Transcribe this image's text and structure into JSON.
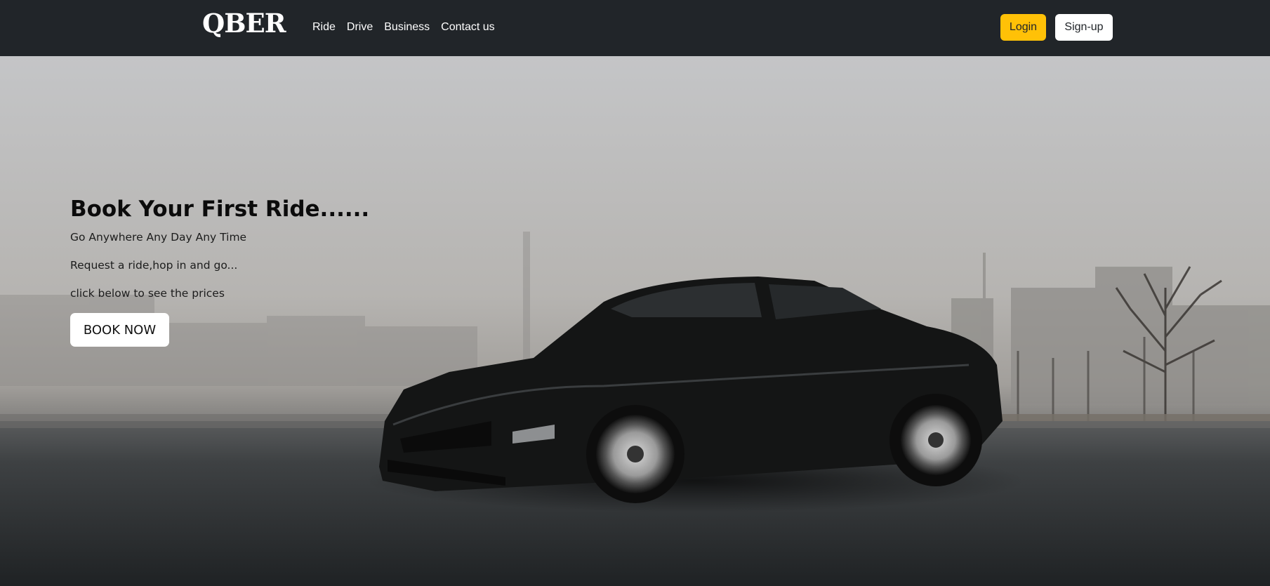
{
  "navbar": {
    "brand": "QBER",
    "links": [
      "Ride",
      "Drive",
      "Business",
      "Contact us"
    ],
    "login_label": "Login",
    "signup_label": "Sign-up"
  },
  "hero": {
    "title": "Book Your First Ride......",
    "line1": "Go Anywhere Any Day Any Time",
    "line2": "Request a ride,hop in and go...",
    "line3": "click below to see the prices",
    "button_label": "BOOK NOW",
    "background_image": "black sports car on foggy asphalt lot"
  },
  "colors": {
    "navbar_bg": "#212529",
    "login_bg": "#ffc107",
    "signup_bg": "#ffffff"
  }
}
